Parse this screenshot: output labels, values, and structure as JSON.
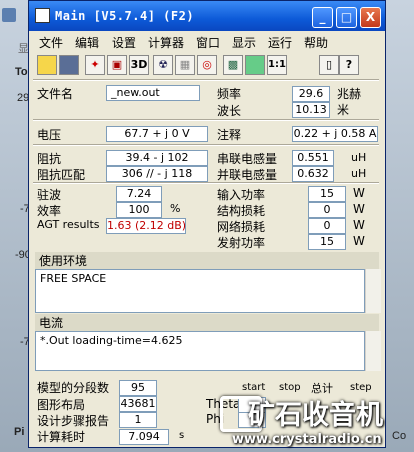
{
  "background": {
    "letters": [
      "显",
      "To",
      "29",
      "-7",
      "-90",
      "-7",
      "Pi",
      "Co"
    ]
  },
  "window": {
    "title": "Main [V5.7.4]  (F2)",
    "controls": [
      "_",
      "□",
      "X"
    ]
  },
  "menu": [
    "文件",
    "编辑",
    "设置",
    "计算器",
    "窗口",
    "显示",
    "运行",
    "帮助"
  ],
  "toolbar": [
    "open-file",
    "save",
    "bulb",
    "cube",
    "3D",
    "radiation",
    "grid",
    "target",
    "module",
    "stack",
    "ratio",
    "book",
    "help"
  ],
  "toolbar_text": [
    "3D",
    "1:1"
  ],
  "fields": {
    "filename_label": "文件名",
    "filename": "_new.out",
    "freq_label": "频率",
    "freq": "29.6",
    "freq_unit": "兆赫",
    "wavelength_label": "波长",
    "wavelength": "10.13",
    "wavelength_unit": "米",
    "voltage_label": "电压",
    "voltage": "67.7 + j 0 V",
    "note_label": "注释",
    "note": "0.22 + j 0.58 A",
    "impedance_label": "阻抗",
    "impedance": "39.4 - j 102",
    "match_label": "阻抗匹配",
    "match": "306 // - j 118",
    "series_label": "串联电感量",
    "series": "0.551",
    "series_unit": "uH",
    "parallel_label": "并联电感量",
    "parallel": "0.632",
    "parallel_unit": "uH",
    "swr_label": "驻波",
    "swr": "7.24",
    "eff_label": "效率",
    "eff": "100",
    "eff_unit": "%",
    "agt_label": "AGT results",
    "agt": "1.63 (2.12 dB)",
    "input_label": "输入功率",
    "input": "15",
    "input_unit": "W",
    "struct_label": "结构损耗",
    "struct": "0",
    "struct_unit": "W",
    "net_label": "网络损耗",
    "net": "0",
    "net_unit": "W",
    "radiated_label": "发射功率",
    "radiated": "15",
    "radiated_unit": "W"
  },
  "env": {
    "title": "使用环境",
    "text": "FREE SPACE"
  },
  "current": {
    "title": "电流",
    "text": "*.Out loading-time=4.625"
  },
  "bottom": {
    "segments_label": "模型的分段数",
    "segments": "95",
    "graph_label": "图形布局",
    "graph": "43681",
    "steps_label": "设计步骤报告",
    "steps": "1",
    "calc_label": "计算耗时",
    "calc": "7.094",
    "calc_unit": "s",
    "col_start": "start",
    "col_stop": "stop",
    "col_total": "总计",
    "col_step": "step",
    "theta": "Theta",
    "phi": "Phi"
  },
  "watermark": {
    "brand": "矿石收音机",
    "url": "www.crystalradio.cn"
  }
}
